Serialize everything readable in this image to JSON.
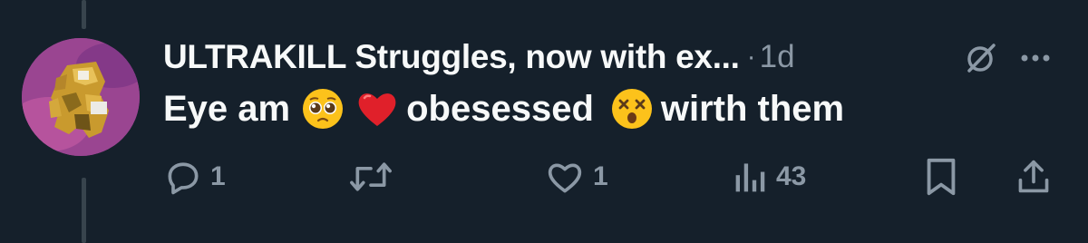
{
  "post": {
    "display_name": "ULTRAKILL Struggles, now with ex...",
    "separator": "·",
    "time": "1d",
    "text_parts": [
      "Eye am",
      "obesessed",
      "wirth them"
    ],
    "emojis": [
      "pleading-face",
      "red-heart",
      "dizzy-face"
    ]
  },
  "actions": {
    "reply_count": "1",
    "repost_count": "",
    "like_count": "1",
    "views_count": "43"
  },
  "colors": {
    "background": "#15202b",
    "text_primary": "#f7f9f9",
    "text_secondary": "#8b98a5",
    "thread_line": "#38444d"
  }
}
